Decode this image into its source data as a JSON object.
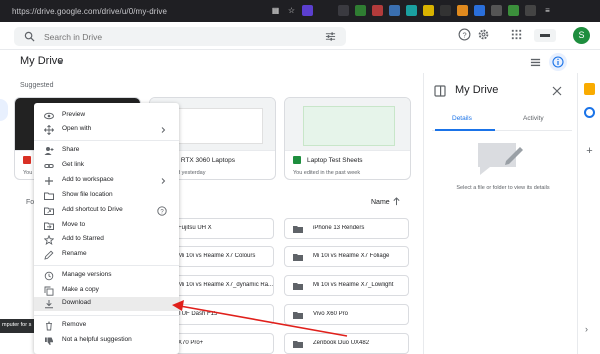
{
  "browser": {
    "url": "https://drive.google.com/drive/u/0/my-drive"
  },
  "header": {
    "search_placeholder": "Search in Drive",
    "avatar_initial": "S"
  },
  "page": {
    "title": "My Drive"
  },
  "suggested": {
    "label": "Suggested",
    "cards": [
      {
        "name": "",
        "sub": "You"
      },
      {
        "name": "st RTX 3060 Laptops",
        "sub": "ed yesterday"
      },
      {
        "name": "Laptop Test Sheets",
        "sub": "You edited in the past week"
      }
    ]
  },
  "folders": {
    "label": "Fo",
    "sort_label": "Name",
    "items": [
      {
        "name": "Fujitsu UH X"
      },
      {
        "name": "iPhone 13 Renders"
      },
      {
        "name": "Mi 10i vs Realme X7 Colours"
      },
      {
        "name": "Mi 10i vs Realme X7 Foliage"
      },
      {
        "name": "Mi 10i vs Realme X7_dynamic Ra..."
      },
      {
        "name": "Mi 10i vs Realme X7_Lowlight"
      },
      {
        "name": "TUF Dash F15"
      },
      {
        "name": "Vivo X60 Pro"
      },
      {
        "name": "X70 Pro+"
      },
      {
        "name": "Zenbook Duo UX482"
      }
    ]
  },
  "context_menu": {
    "items": [
      {
        "label": "Preview",
        "icon": "eye-icon"
      },
      {
        "label": "Open with",
        "icon": "move-arrows-icon",
        "submenu": true
      },
      {
        "label": "Share",
        "icon": "person-add-icon"
      },
      {
        "label": "Get link",
        "icon": "link-icon"
      },
      {
        "label": "Add to workspace",
        "icon": "plus-icon",
        "submenu": true
      },
      {
        "label": "Show file location",
        "icon": "folder-icon"
      },
      {
        "label": "Add shortcut to Drive",
        "icon": "shortcut-icon"
      },
      {
        "label": "Move to",
        "icon": "move-to-icon"
      },
      {
        "label": "Add to Starred",
        "icon": "star-icon"
      },
      {
        "label": "Rename",
        "icon": "pencil-icon"
      },
      {
        "label": "Manage versions",
        "icon": "history-icon"
      },
      {
        "label": "Make a copy",
        "icon": "copy-icon"
      },
      {
        "label": "Download",
        "icon": "download-icon",
        "highlighted": true
      },
      {
        "label": "Remove",
        "icon": "trash-icon"
      },
      {
        "label": "Not a helpful suggestion",
        "icon": "thumbs-down-icon"
      }
    ]
  },
  "details_panel": {
    "title": "My Drive",
    "tabs": [
      "Details",
      "Activity"
    ],
    "active_tab": "Details",
    "empty_message": "Select a file or folder to view its details"
  },
  "tooltip": {
    "text": "mputer for s"
  },
  "colors": {
    "accent": "#1a73e8",
    "annotation_arrow": "#e0201b",
    "avatar_bg": "#1e8e3e",
    "browser_bar": "#1f1f23"
  }
}
